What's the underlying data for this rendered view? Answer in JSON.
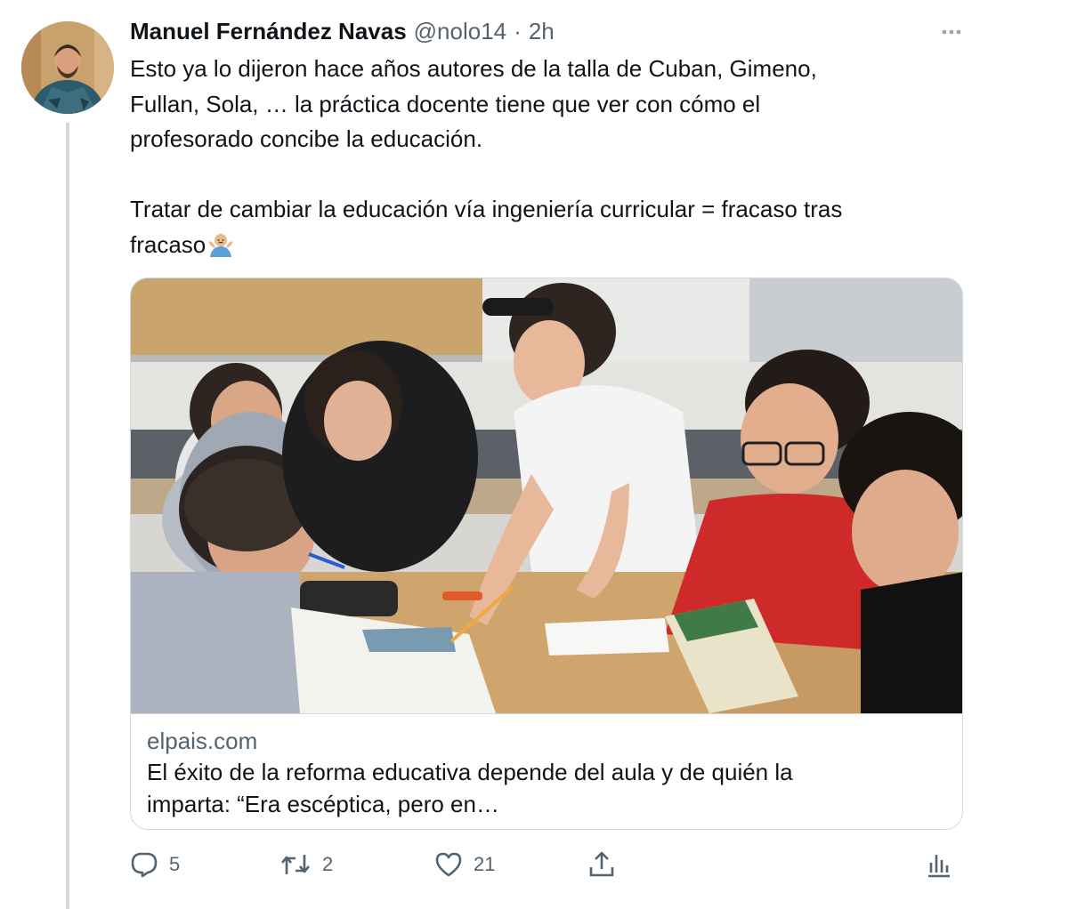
{
  "tweet": {
    "author_name": "Manuel Fernández Navas",
    "handle": "@nolo14",
    "separator": "·",
    "time": "2h",
    "more_icon": "more-horizontal-icon",
    "text_lines": [
      "Esto ya lo dijeron hace años autores de la talla de Cuban, Gimeno,",
      "Fullan, Sola, … la práctica docente tiene que ver con cómo el",
      "profesorado concibe la educación.",
      "Tratar de cambiar la educación vía ingeniería curricular = fracaso tras",
      "fracaso"
    ],
    "emoji": "shrug-emoji"
  },
  "card": {
    "domain": "elpais.com",
    "title_lines": [
      "El éxito de la reforma educativa depende del aula y de quién la",
      "imparta: “Era escéptica, pero en…"
    ]
  },
  "actions": {
    "reply": {
      "icon": "reply-icon",
      "count": "5"
    },
    "retweet": {
      "icon": "retweet-icon",
      "count": "2"
    },
    "like": {
      "icon": "heart-icon",
      "count": "21"
    },
    "share": {
      "icon": "share-icon"
    },
    "analytics": {
      "icon": "analytics-icon"
    }
  },
  "colors": {
    "text_primary": "#0f1419",
    "text_secondary": "#536471",
    "border": "#cfd9de"
  }
}
